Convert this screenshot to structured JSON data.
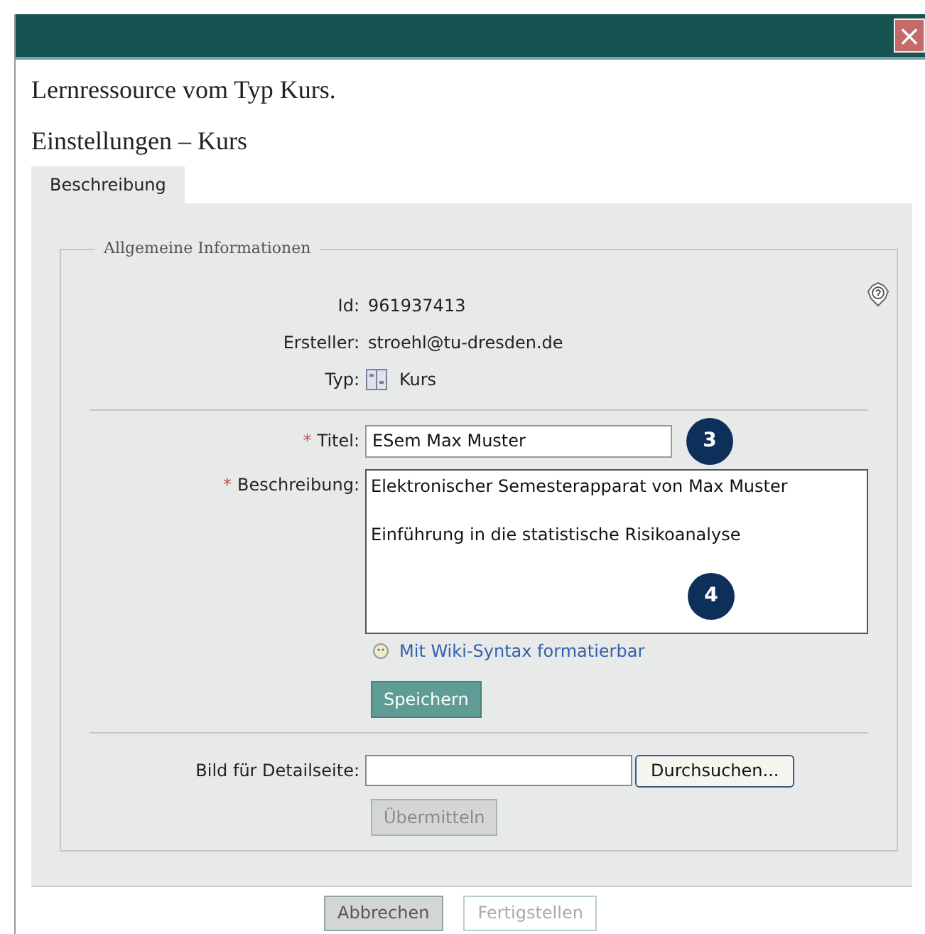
{
  "window": {
    "close_button": "×"
  },
  "intro": "Lernressource vom Typ Kurs.",
  "heading": "Einstellungen – Kurs",
  "tabs": [
    {
      "label": "Beschreibung",
      "selected": true
    }
  ],
  "fieldset": {
    "legend": "Allgemeine Informationen",
    "info_rows": [
      {
        "label": "Id:",
        "value": "961937413",
        "kind": "text"
      },
      {
        "label": "Ersteller:",
        "value": "stroehl@tu-dresden.de",
        "kind": "text"
      },
      {
        "label": "Typ:",
        "value": "Kurs",
        "kind": "icon"
      }
    ],
    "title_field": {
      "label": "Titel:",
      "required_mark": "*",
      "value": "ESem Max Muster",
      "badge": "3"
    },
    "description_field": {
      "label": "Beschreibung:",
      "required_mark": "*",
      "paragraphs": [
        "Elektronischer Semesterapparat von Max Muster",
        "Einführung in die statistische Risikoanalyse"
      ],
      "badge": "4"
    },
    "wiki_link": "Mit Wiki-Syntax formatierbar",
    "save_button": {
      "label": "Speichern",
      "disabled": false
    },
    "image_field": {
      "label": "Bild für Detailseite:",
      "browse": "Durchsuchen..."
    },
    "submit_button": {
      "label": "Übermitteln",
      "disabled": true
    }
  },
  "footer_buttons": [
    {
      "label": "Abbrechen",
      "disabled": false
    },
    {
      "label": "Fertigstellen",
      "disabled": true
    }
  ]
}
